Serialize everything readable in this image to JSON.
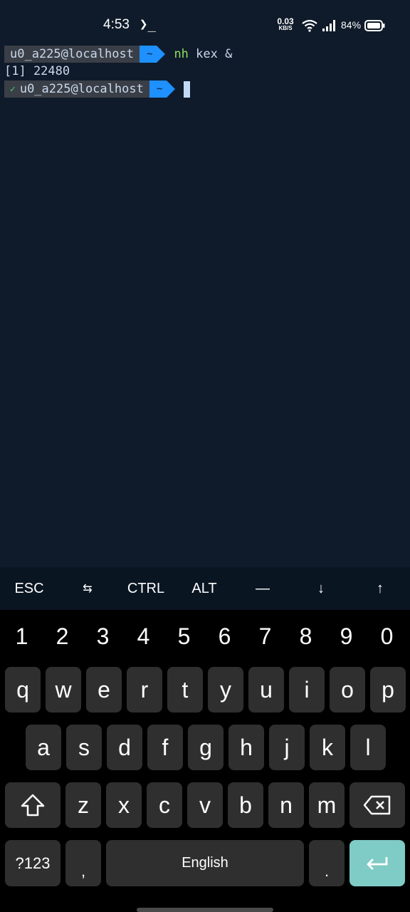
{
  "status_bar": {
    "time": "4:53",
    "terminal_indicator": "❯_",
    "net_speed_value": "0.03",
    "net_speed_unit": "KB/S",
    "battery_percent": "84%"
  },
  "terminal": {
    "line1": {
      "user_host": "u0_a225@localhost",
      "dir": "~",
      "command_bin": "nh",
      "command_args": " kex &"
    },
    "line2": {
      "text": "[1] 22480"
    },
    "line3": {
      "status_glyph": "✓",
      "user_host": "u0_a225@localhost",
      "dir": "~"
    }
  },
  "extra_keys": [
    "ESC",
    "⇆",
    "CTRL",
    "ALT",
    "—",
    "↓",
    "↑"
  ],
  "keyboard": {
    "numbers": [
      "1",
      "2",
      "3",
      "4",
      "5",
      "6",
      "7",
      "8",
      "9",
      "0"
    ],
    "row1": [
      "q",
      "w",
      "e",
      "r",
      "t",
      "y",
      "u",
      "i",
      "o",
      "p"
    ],
    "row2": [
      "a",
      "s",
      "d",
      "f",
      "g",
      "h",
      "j",
      "k",
      "l"
    ],
    "row3": [
      "z",
      "x",
      "c",
      "v",
      "b",
      "n",
      "m"
    ],
    "symbols_label": "?123",
    "comma": ",",
    "space_label": "English",
    "period": "."
  },
  "colors": {
    "terminal_bg": "#0f1b2a",
    "prompt_bg": "#3a3f47",
    "dir_bg": "#1e90ff",
    "command_color": "#8fdc62",
    "enter_key": "#7fcbc5"
  },
  "icons": [
    "terminal-icon",
    "wifi-icon",
    "signal-icon",
    "battery-icon",
    "shift-icon",
    "backspace-icon",
    "enter-icon"
  ]
}
